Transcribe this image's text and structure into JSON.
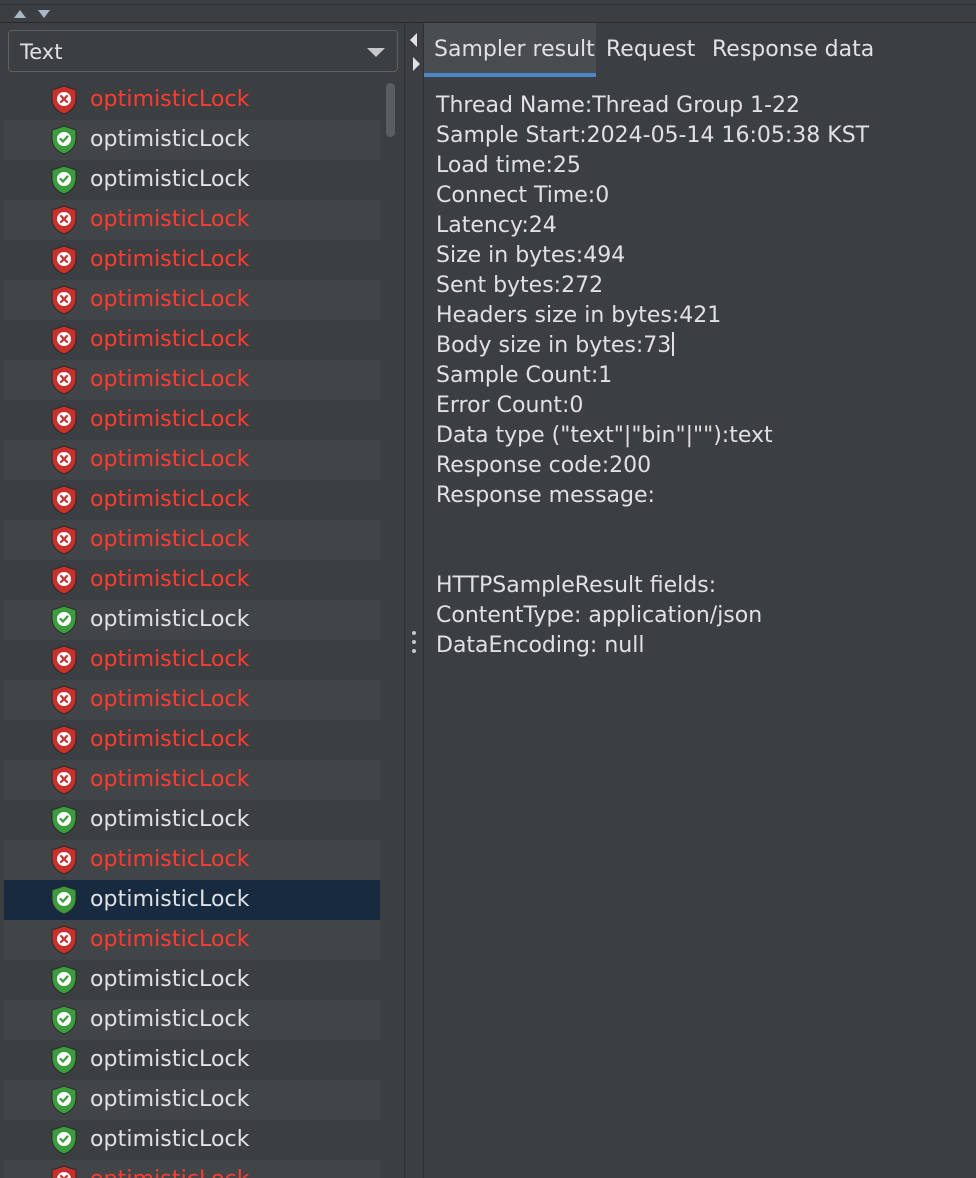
{
  "view_selector": {
    "value": "Text"
  },
  "tabs": [
    "Sampler result",
    "Request",
    "Response data"
  ],
  "active_tab": 0,
  "results": [
    {
      "name": "optimisticLock",
      "status": "error"
    },
    {
      "name": "optimisticLock",
      "status": "success"
    },
    {
      "name": "optimisticLock",
      "status": "success"
    },
    {
      "name": "optimisticLock",
      "status": "error"
    },
    {
      "name": "optimisticLock",
      "status": "error"
    },
    {
      "name": "optimisticLock",
      "status": "error"
    },
    {
      "name": "optimisticLock",
      "status": "error"
    },
    {
      "name": "optimisticLock",
      "status": "error"
    },
    {
      "name": "optimisticLock",
      "status": "error"
    },
    {
      "name": "optimisticLock",
      "status": "error"
    },
    {
      "name": "optimisticLock",
      "status": "error"
    },
    {
      "name": "optimisticLock",
      "status": "error"
    },
    {
      "name": "optimisticLock",
      "status": "error"
    },
    {
      "name": "optimisticLock",
      "status": "success"
    },
    {
      "name": "optimisticLock",
      "status": "error"
    },
    {
      "name": "optimisticLock",
      "status": "error"
    },
    {
      "name": "optimisticLock",
      "status": "error"
    },
    {
      "name": "optimisticLock",
      "status": "error"
    },
    {
      "name": "optimisticLock",
      "status": "success"
    },
    {
      "name": "optimisticLock",
      "status": "error"
    },
    {
      "name": "optimisticLock",
      "status": "success",
      "selected": true
    },
    {
      "name": "optimisticLock",
      "status": "error"
    },
    {
      "name": "optimisticLock",
      "status": "success"
    },
    {
      "name": "optimisticLock",
      "status": "success"
    },
    {
      "name": "optimisticLock",
      "status": "success"
    },
    {
      "name": "optimisticLock",
      "status": "success"
    },
    {
      "name": "optimisticLock",
      "status": "success"
    },
    {
      "name": "optimisticLock",
      "status": "error"
    }
  ],
  "sampler_result_lines": [
    "Thread Name:Thread Group 1-22",
    "Sample Start:2024-05-14 16:05:38 KST",
    "Load time:25",
    "Connect Time:0",
    "Latency:24",
    "Size in bytes:494",
    "Sent bytes:272",
    "Headers size in bytes:421",
    "Body size in bytes:73",
    "Sample Count:1",
    "Error Count:0",
    "Data type (\"text\"|\"bin\"|\"\"):text",
    "Response code:200",
    "Response message:",
    "",
    "",
    "HTTPSampleResult fields:",
    "ContentType: application/json",
    "DataEncoding: null"
  ],
  "text_cursor_line": 8,
  "colors": {
    "background": "#3c3f41",
    "error_text": "#ff3b30",
    "normal_text": "#dfe1e5",
    "selected_row": "#172a40",
    "alt_row": "#424548",
    "tab_underline": "#4a88c7",
    "icon_error": "#c9302c",
    "icon_success": "#3c9b3c"
  },
  "icons": {
    "error": "shield-x-icon",
    "success": "shield-check-icon"
  }
}
